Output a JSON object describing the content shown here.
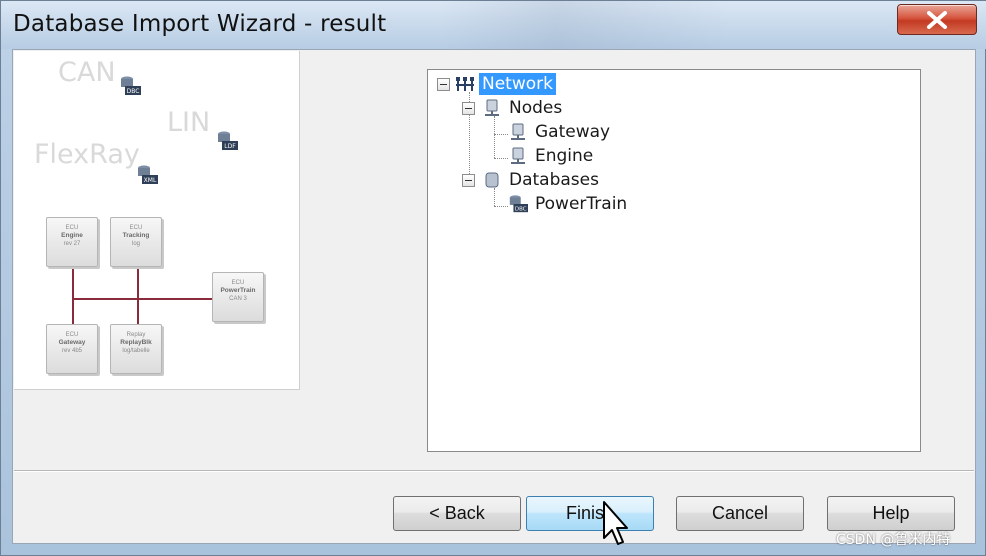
{
  "window": {
    "title": "Database Import Wizard - result",
    "close_label": "✕"
  },
  "illustration": {
    "bus_labels": [
      "CAN",
      "LIN",
      "FlexRay"
    ],
    "file_badges": [
      "DBC",
      "LDF",
      "XML"
    ],
    "ecus": [
      {
        "type": "ECU",
        "name": "Engine",
        "sub": "rev 27"
      },
      {
        "type": "ECU",
        "name": "Tracking",
        "sub": "log"
      },
      {
        "type": "ECU",
        "name": "PowerTrain",
        "sub": "CAN 3"
      },
      {
        "type": "ECU",
        "name": "Gateway",
        "sub": "rev 4b5"
      },
      {
        "type": "Replay",
        "name": "ReplayBlk",
        "sub": "log/tabelle"
      }
    ]
  },
  "tree": {
    "network": "Network",
    "nodes": "Nodes",
    "gateway": "Gateway",
    "engine": "Engine",
    "databases": "Databases",
    "powertrain": "PowerTrain",
    "dbc_badge": "DBC"
  },
  "buttons": {
    "back": "< Back",
    "finish": "Finish",
    "cancel": "Cancel",
    "help": "Help"
  },
  "watermark": "CSDN @鲁米内特",
  "colors": {
    "selection": "#3399ff",
    "bus_line": "#8b2a3a",
    "close_button": "#c33a22"
  }
}
